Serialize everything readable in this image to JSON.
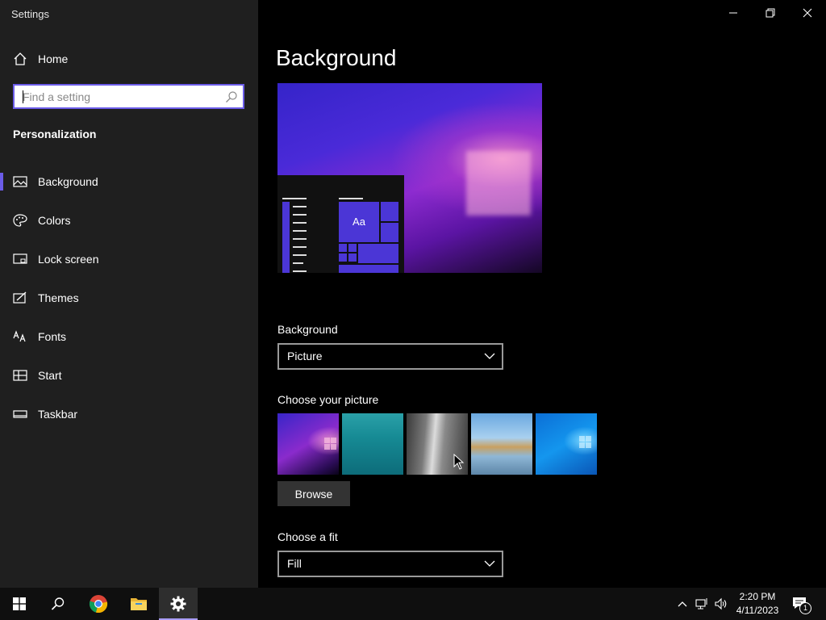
{
  "window": {
    "title": "Settings"
  },
  "sidebar": {
    "home_label": "Home",
    "search_placeholder": "Find a setting",
    "section_title": "Personalization",
    "items": [
      {
        "label": "Background",
        "icon": "picture-icon",
        "selected": true
      },
      {
        "label": "Colors",
        "icon": "palette-icon",
        "selected": false
      },
      {
        "label": "Lock screen",
        "icon": "lock-screen-icon",
        "selected": false
      },
      {
        "label": "Themes",
        "icon": "themes-icon",
        "selected": false
      },
      {
        "label": "Fonts",
        "icon": "fonts-icon",
        "selected": false
      },
      {
        "label": "Start",
        "icon": "start-icon",
        "selected": false
      },
      {
        "label": "Taskbar",
        "icon": "taskbar-icon",
        "selected": false
      }
    ]
  },
  "main": {
    "title": "Background",
    "preview": {
      "tile_text": "Aa"
    },
    "background_label": "Background",
    "background_value": "Picture",
    "choose_picture_label": "Choose your picture",
    "pictures": [
      "purple-bloom",
      "underwater-swimmer",
      "waterfall-cliff",
      "beach-rocks",
      "blue-windows-logo"
    ],
    "browse_label": "Browse",
    "fit_label": "Choose a fit",
    "fit_value": "Fill"
  },
  "taskbar": {
    "apps": [
      "start-icon",
      "search-icon",
      "chrome-icon",
      "file-explorer-icon",
      "settings-icon"
    ],
    "active_app": "settings-icon",
    "time": "2:20 PM",
    "date": "4/11/2023",
    "notification_count": "1"
  },
  "colors": {
    "accent": "#6b5ce8",
    "sidebar_bg": "#1f1f1f",
    "main_bg": "#000000",
    "taskbar_bg": "#0f0f0f"
  }
}
